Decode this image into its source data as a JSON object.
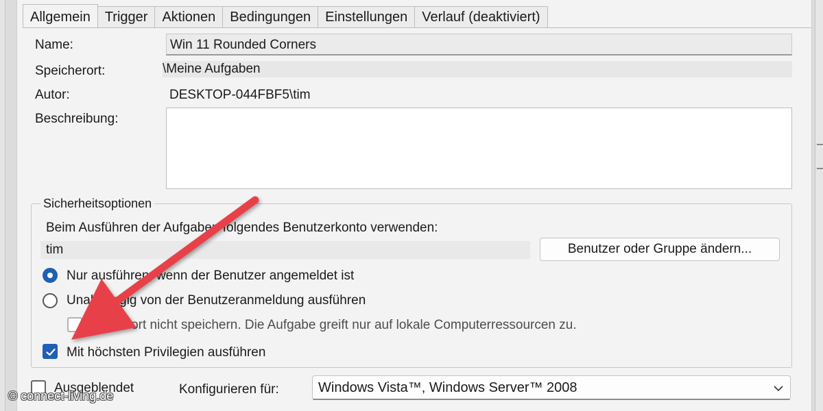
{
  "tabs": [
    {
      "label": "Allgemein",
      "active": true
    },
    {
      "label": "Trigger",
      "active": false
    },
    {
      "label": "Aktionen",
      "active": false
    },
    {
      "label": "Bedingungen",
      "active": false
    },
    {
      "label": "Einstellungen",
      "active": false
    },
    {
      "label": "Verlauf (deaktiviert)",
      "active": false
    }
  ],
  "general": {
    "name_label": "Name:",
    "name_value": "Win 11 Rounded Corners",
    "location_label": "Speicherort:",
    "location_value": "\\Meine Aufgaben",
    "author_label": "Autor:",
    "author_value": "DESKTOP-044FBF5\\tim",
    "description_label": "Beschreibung:",
    "description_value": ""
  },
  "security": {
    "group_title": "Sicherheitsoptionen",
    "account_prompt": "Beim Ausführen der Aufgaben folgendes Benutzerkonto verwenden:",
    "user_value": "tim",
    "change_button": "Benutzer oder Gruppe ändern...",
    "radio_logged_on": {
      "label": "Nur ausführen, wenn der Benutzer angemeldet ist",
      "checked": true
    },
    "radio_whether": {
      "label": "Unabhängig von der Benutzeranmeldung ausführen",
      "checked": false
    },
    "no_password": {
      "label": "Kennwort nicht speichern. Die Aufgabe greift nur auf lokale Computerressourcen zu.",
      "checked": false,
      "enabled": false
    },
    "highest_privileges": {
      "label": "Mit höchsten Privilegien ausführen",
      "checked": true
    }
  },
  "footer": {
    "hidden_label": "Ausgeblendet",
    "hidden_checked": false,
    "configure_label": "Konfigurieren für:",
    "configure_value": "Windows Vista™, Windows Server™ 2008"
  },
  "colors": {
    "accent": "#1f5fb5",
    "arrow": "#e8404a"
  },
  "watermark": "© connect-living.de"
}
